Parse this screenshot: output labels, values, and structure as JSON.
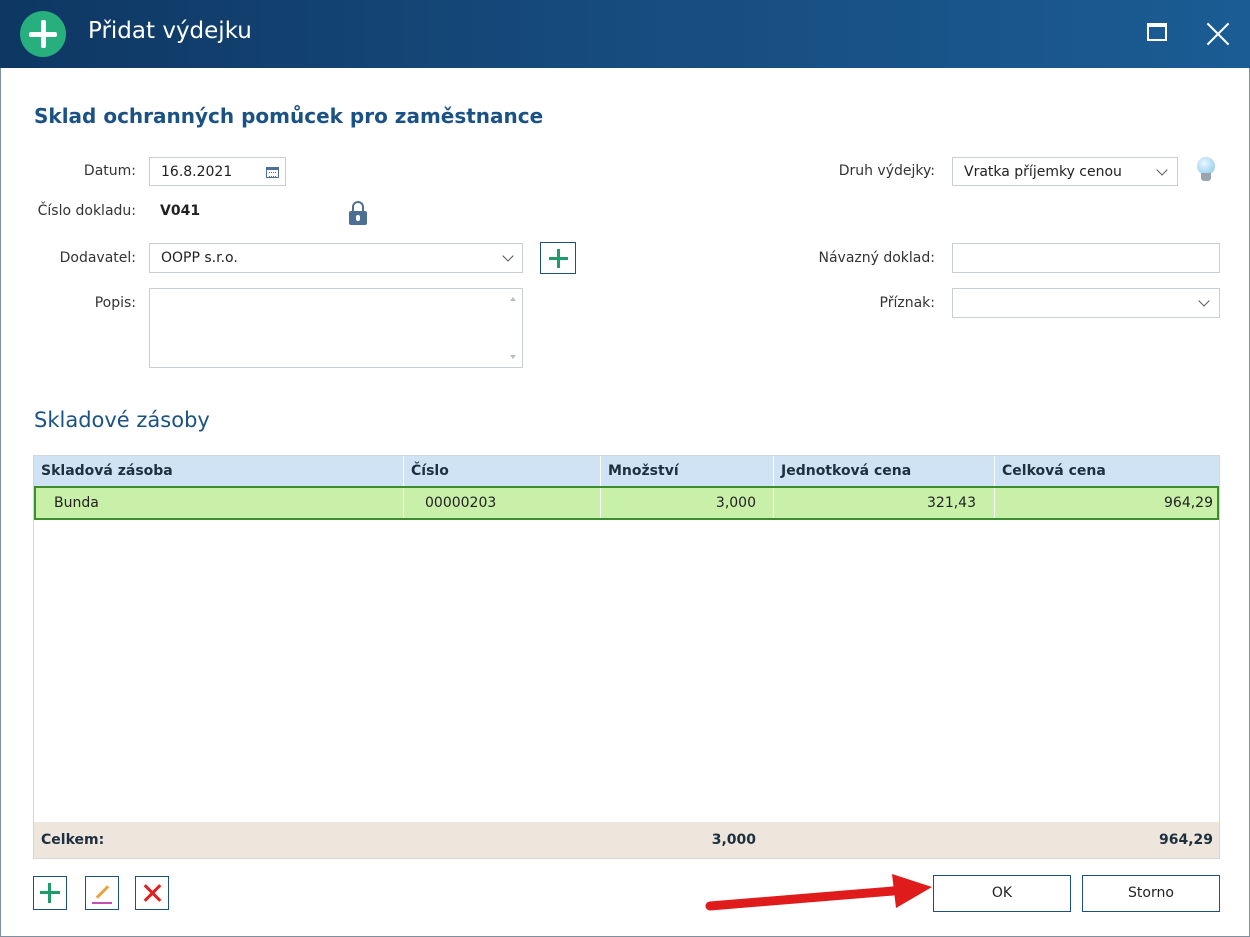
{
  "window": {
    "title": "Přidat výdejku"
  },
  "form": {
    "heading": "Sklad ochranných pomůcek pro zaměstnance",
    "date_label": "Datum:",
    "date_value": "16.8.2021",
    "doc_number_label": "Číslo dokladu:",
    "doc_number_value": "V041",
    "supplier_label": "Dodavatel:",
    "supplier_value": "OOPP s.r.o.",
    "description_label": "Popis:",
    "description_value": "",
    "issue_type_label": "Druh výdejky:",
    "issue_type_value": "Vratka příjemky cenou",
    "related_doc_label": "Návazný doklad:",
    "related_doc_value": "",
    "flag_label": "Příznak:",
    "flag_value": ""
  },
  "stock": {
    "section_title": "Skladové zásoby",
    "columns": [
      "Skladová zásoba",
      "Číslo",
      "Množství",
      "Jednotková cena",
      "Celková cena"
    ],
    "rows": [
      {
        "item": "Bunda",
        "number": "00000203",
        "quantity": "3,000",
        "unit_price": "321,43",
        "total_price": "964,29"
      }
    ],
    "footer": {
      "label": "Celkem:",
      "quantity": "3,000",
      "total": "964,29"
    }
  },
  "buttons": {
    "ok": "OK",
    "cancel": "Storno"
  },
  "icons": {
    "title": "add-circle-icon",
    "maximize": "maximize-icon",
    "close": "close-icon",
    "calendar": "calendar-icon",
    "lock": "lock-icon",
    "add": "plus-icon",
    "bulb": "lightbulb-icon",
    "edit": "pencil-icon",
    "delete": "delete-x-icon",
    "arrow": "red-arrow-icon"
  },
  "colors": {
    "titlebar": "#164a7c",
    "accent_green": "#27b07d",
    "selected_row": "#c9f0a8",
    "header_row": "#cfe3f4",
    "footer_row": "#eee5dc",
    "arrow": "#e01b1b"
  }
}
